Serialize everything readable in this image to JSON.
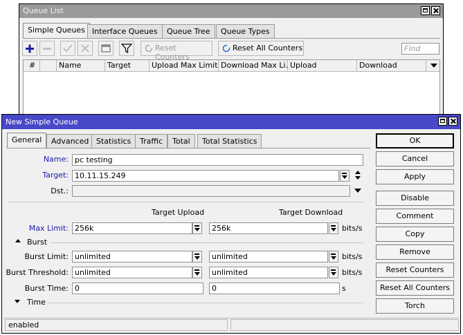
{
  "queue_window": {
    "title": "Queue List",
    "tabs": [
      "Simple Queues",
      "Interface Queues",
      "Queue Tree",
      "Queue Types"
    ],
    "toolbar": {
      "reset_counters": "Reset Counters",
      "reset_all_counters": "Reset All Counters",
      "find_placeholder": "Find"
    },
    "columns": [
      "#",
      "",
      "Name",
      "Target",
      "Upload Max Limit",
      "Download Max Li...",
      "Upload",
      "Download"
    ]
  },
  "dialog": {
    "title": "New Simple Queue",
    "tabs": [
      "General",
      "Advanced",
      "Statistics",
      "Traffic",
      "Total",
      "Total Statistics"
    ],
    "name_label": "Name:",
    "name_value": "pc testing",
    "target_label": "Target:",
    "target_value": "10.11.15.249",
    "dst_label": "Dst.:",
    "dst_value": "",
    "target_upload_header": "Target Upload",
    "target_download_header": "Target Download",
    "max_limit_label": "Max Limit:",
    "max_limit_upload": "256k",
    "max_limit_download": "256k",
    "unit_bits": "bits/s",
    "burst_section": "Burst",
    "burst_limit_label": "Burst Limit:",
    "burst_limit_upload": "unlimited",
    "burst_limit_download": "unlimited",
    "burst_threshold_label": "Burst Threshold:",
    "burst_threshold_upload": "unlimited",
    "burst_threshold_download": "unlimited",
    "burst_time_label": "Burst Time:",
    "burst_time_upload": "0",
    "burst_time_download": "0",
    "unit_s": "s",
    "time_section": "Time",
    "status": "enabled",
    "buttons": {
      "ok": "OK",
      "cancel": "Cancel",
      "apply": "Apply",
      "disable": "Disable",
      "comment": "Comment",
      "copy": "Copy",
      "remove": "Remove",
      "reset_counters": "Reset Counters",
      "reset_all_counters": "Reset All Counters",
      "torch": "Torch"
    }
  },
  "colors": {
    "queue_title_bar": "#9a9a9a",
    "dialog_title_bar": "#4848c8",
    "label_blue": "#1a1aa8",
    "add_blue": "#1e1ea0"
  }
}
